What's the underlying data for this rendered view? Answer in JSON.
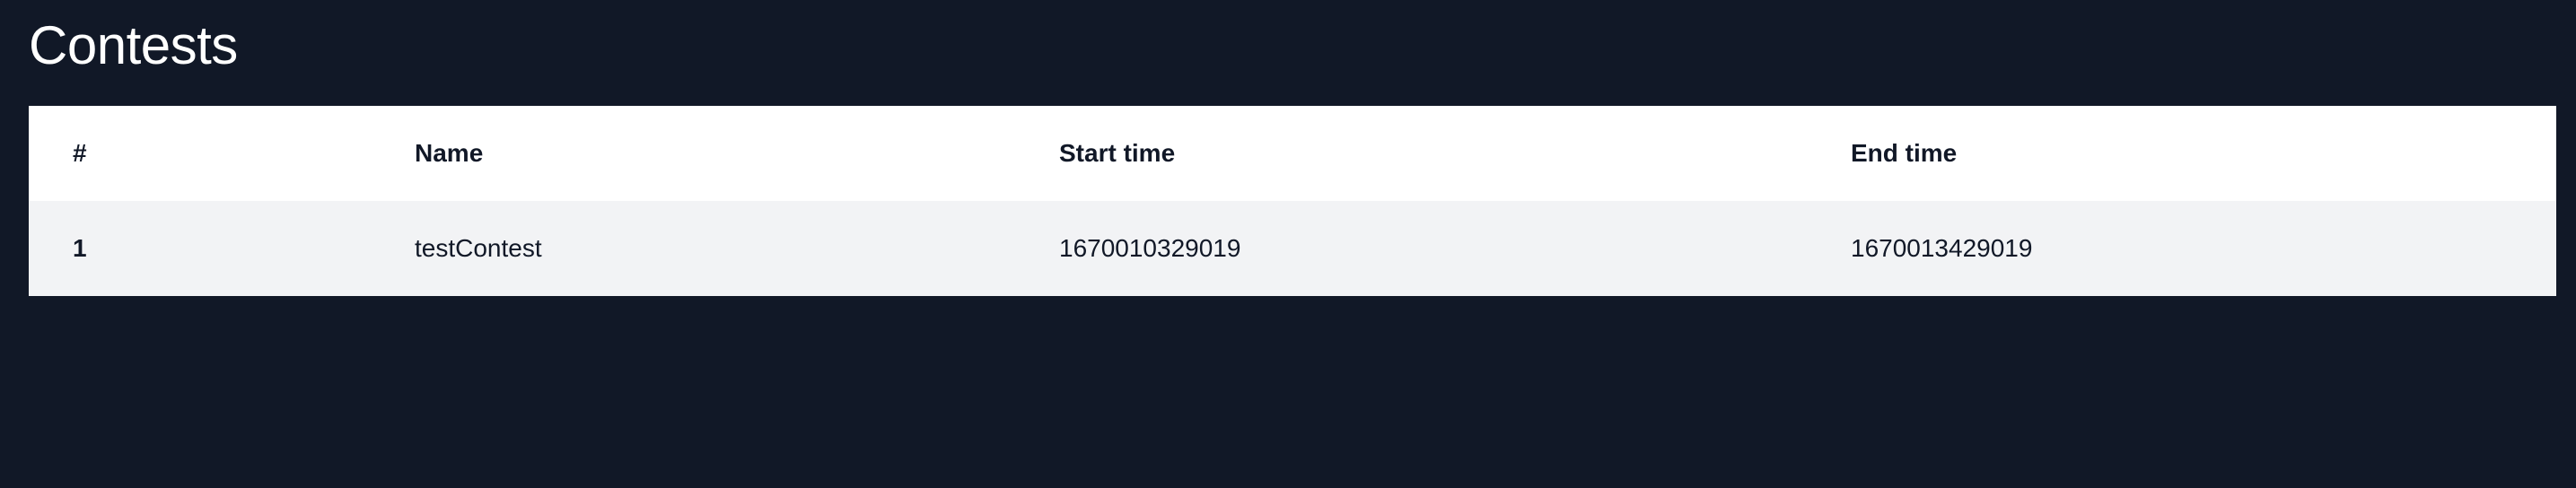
{
  "page": {
    "title": "Contests"
  },
  "table": {
    "headers": [
      "#",
      "Name",
      "Start time",
      "End time"
    ],
    "rows": [
      {
        "index": "1",
        "name": "testContest",
        "start_time": "1670010329019",
        "end_time": "1670013429019"
      }
    ]
  },
  "colors": {
    "background": "#111827",
    "header_row": "#ffffff",
    "body_row": "#f2f3f5",
    "text": "#111827"
  }
}
